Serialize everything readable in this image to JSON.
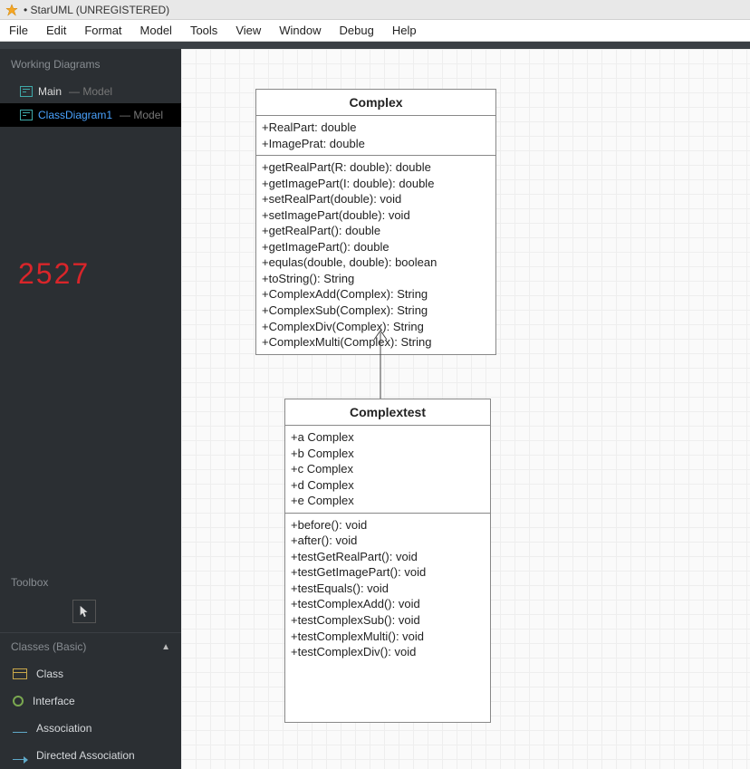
{
  "window": {
    "title": "• StarUML (UNREGISTERED)"
  },
  "menu": [
    "File",
    "Edit",
    "Format",
    "Model",
    "Tools",
    "View",
    "Window",
    "Debug",
    "Help"
  ],
  "sidebar": {
    "header": "Working Diagrams",
    "items": [
      {
        "label": "Main",
        "suffix": "— Model",
        "selected": false,
        "link": false
      },
      {
        "label": "ClassDiagram1",
        "suffix": "— Model",
        "selected": true,
        "link": true
      }
    ],
    "annotation": "2527"
  },
  "toolbox": {
    "header": "Toolbox",
    "section": "Classes (Basic)",
    "items": [
      {
        "icon": "class-icon",
        "label": "Class"
      },
      {
        "icon": "interface-icon",
        "label": "Interface"
      },
      {
        "icon": "association-icon",
        "label": "Association"
      },
      {
        "icon": "directed-association-icon",
        "label": "Directed Association"
      }
    ]
  },
  "diagram": {
    "classes": [
      {
        "id": "Complex",
        "name": "Complex",
        "attributes": [
          "+RealPart: double",
          "+ImagePrat: double"
        ],
        "operations": [
          "+getRealPart(R: double): double",
          "+getImagePart(I: double): double",
          "+setRealPart(double): void",
          "+setImagePart(double): void",
          "+getRealPart(): double",
          "+getImagePart(): double",
          "+equlas(double, double): boolean",
          "+toString(): String",
          "+ComplexAdd(Complex): String",
          "+ComplexSub(Complex): String",
          "+ComplexDiv(Complex): String",
          "+ComplexMulti(Complex): String"
        ]
      },
      {
        "id": "Complextest",
        "name": "Complextest",
        "attributes": [
          "+a Complex",
          "+b Complex",
          "+c Complex",
          "+d Complex",
          "+e Complex"
        ],
        "operations": [
          "+before(): void",
          "+after(): void",
          "+testGetRealPart(): void",
          "+testGetImagePart(): void",
          "+testEquals(): void",
          "+testComplexAdd(): void",
          "+testComplexSub(): void",
          "+testComplexMulti(): void",
          "+testComplexDiv(): void"
        ]
      }
    ],
    "relations": [
      {
        "from": "Complextest",
        "to": "Complex",
        "type": "dependency"
      }
    ]
  }
}
